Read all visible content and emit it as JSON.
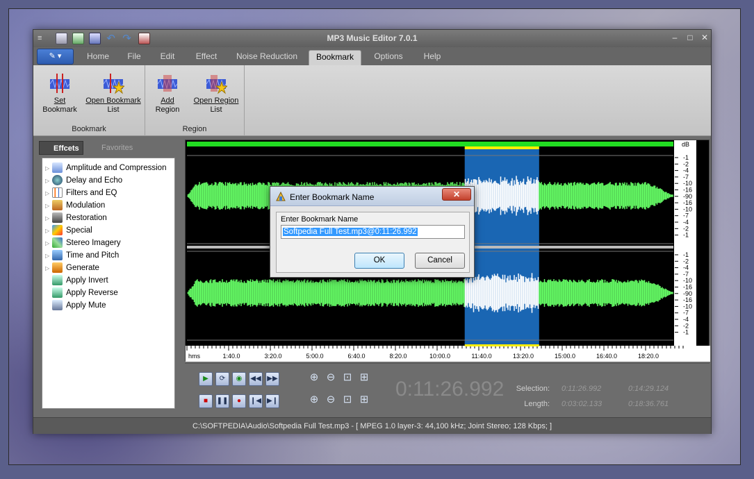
{
  "window": {
    "title": "MP3 Music Editor 7.0.1"
  },
  "tabs": [
    {
      "label": "Home"
    },
    {
      "label": "File"
    },
    {
      "label": "Edit"
    },
    {
      "label": "Effect"
    },
    {
      "label": "Noise Reduction"
    },
    {
      "label": "Bookmark",
      "active": true
    },
    {
      "label": "Options"
    },
    {
      "label": "Help"
    }
  ],
  "ribbon": {
    "groups": [
      {
        "label": "Bookmark",
        "buttons": [
          {
            "label1": "Set",
            "label2": "Bookmark"
          },
          {
            "label1": "Open Bookmark",
            "label2": "List"
          }
        ]
      },
      {
        "label": "Region",
        "buttons": [
          {
            "label1": "Add",
            "label2": "Region"
          },
          {
            "label1": "Open Region",
            "label2": "List"
          }
        ]
      }
    ]
  },
  "panel": {
    "tab_effects": "Effcets",
    "tab_favorites": "Favorites",
    "items": [
      {
        "label": "Amplitude and Compression",
        "expandable": true,
        "icon": "amplitude-icon"
      },
      {
        "label": "Delay and Echo",
        "expandable": true,
        "icon": "delay-icon"
      },
      {
        "label": "Filters and EQ",
        "expandable": true,
        "icon": "filter-icon"
      },
      {
        "label": "Modulation",
        "expandable": true,
        "icon": "modulation-icon"
      },
      {
        "label": "Restoration",
        "expandable": true,
        "icon": "restoration-icon"
      },
      {
        "label": "Special",
        "expandable": true,
        "icon": "special-icon"
      },
      {
        "label": "Stereo Imagery",
        "expandable": true,
        "icon": "stereo-icon"
      },
      {
        "label": "Time and Pitch",
        "expandable": true,
        "icon": "time-pitch-icon"
      },
      {
        "label": "Generate",
        "expandable": true,
        "icon": "generate-icon"
      },
      {
        "label": "Apply Invert",
        "expandable": false,
        "icon": "invert-icon"
      },
      {
        "label": "Apply Reverse",
        "expandable": false,
        "icon": "reverse-icon"
      },
      {
        "label": "Apply Mute",
        "expandable": false,
        "icon": "mute-icon"
      }
    ]
  },
  "waveform": {
    "db_label": "dB",
    "db_ticks_top": [
      "-1",
      "-2",
      "-4",
      "-7",
      "-10",
      "-16",
      "-90",
      "-16",
      "-10",
      "-7",
      "-4",
      "-2",
      "-1"
    ],
    "db_ticks_bottom": [
      "-1",
      "-2",
      "-4",
      "-7",
      "-10",
      "-16",
      "-90",
      "-16",
      "-10",
      "-7",
      "-4",
      "-2",
      "-1"
    ],
    "time_ticks": [
      "hms",
      "1:40.0",
      "3:20.0",
      "5:00.0",
      "6:40.0",
      "8:20.0",
      "10:00.0",
      "11:40.0",
      "13:20.0",
      "15:00.0",
      "16:40.0",
      "18:20.0"
    ],
    "wave_color": "#66ff66",
    "selection_color": "#1a66b3",
    "selection_start_fraction": 0.571,
    "selection_end_fraction": 0.724
  },
  "transport": {
    "current_time": "0:11:26.992",
    "selection_label": "Selection:",
    "selection_start": "0:11:26.992",
    "selection_end": "0:14:29.124",
    "length_label": "Length:",
    "length_value": "0:03:02.133",
    "total_length": "0:18:36.761"
  },
  "status": {
    "text": "C:\\SOFTPEDIA\\Audio\\Softpedia Full Test.mp3 - [ MPEG 1.0 layer-3: 44,100 kHz; Joint Stereo; 128 Kbps; ]"
  },
  "dialog": {
    "title": "Enter Bookmark Name",
    "close_label": "✕",
    "field_label": "Enter Bookmark Name",
    "field_value": "Softpedia Full Test.mp3@0:11:26.992",
    "ok_label": "OK",
    "cancel_label": "Cancel"
  }
}
